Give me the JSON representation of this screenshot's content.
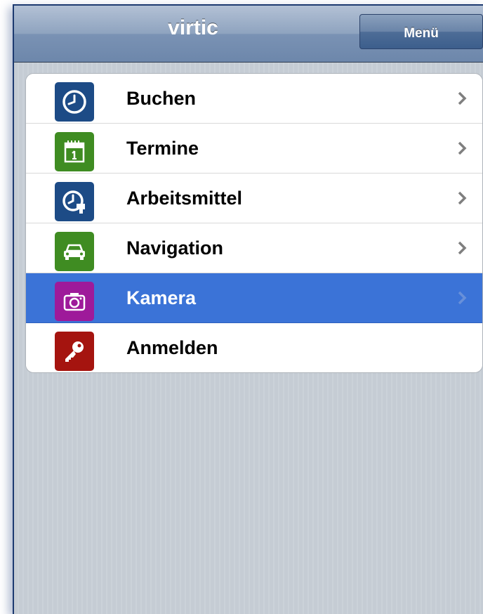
{
  "navbar": {
    "title": "virtic",
    "menu_button_label": "Menü"
  },
  "menu": {
    "items": [
      {
        "label": "Buchen",
        "icon": "clock-icon",
        "icon_color": "#1d4b86",
        "has_chevron": true,
        "selected": false
      },
      {
        "label": "Termine",
        "icon": "calendar-icon",
        "icon_color": "#3f8c22",
        "has_chevron": true,
        "selected": false
      },
      {
        "label": "Arbeitsmittel",
        "icon": "clock-tool-icon",
        "icon_color": "#1d4b86",
        "has_chevron": true,
        "selected": false
      },
      {
        "label": "Navigation",
        "icon": "car-icon",
        "icon_color": "#3f8c22",
        "has_chevron": true,
        "selected": false
      },
      {
        "label": "Kamera",
        "icon": "camera-icon",
        "icon_color": "#9e1a9a",
        "has_chevron": true,
        "selected": true
      },
      {
        "label": "Anmelden",
        "icon": "key-icon",
        "icon_color": "#a5140f",
        "has_chevron": false,
        "selected": false
      }
    ]
  },
  "colors": {
    "selection": "#3b73d7",
    "navbar": "#7a92b4"
  }
}
